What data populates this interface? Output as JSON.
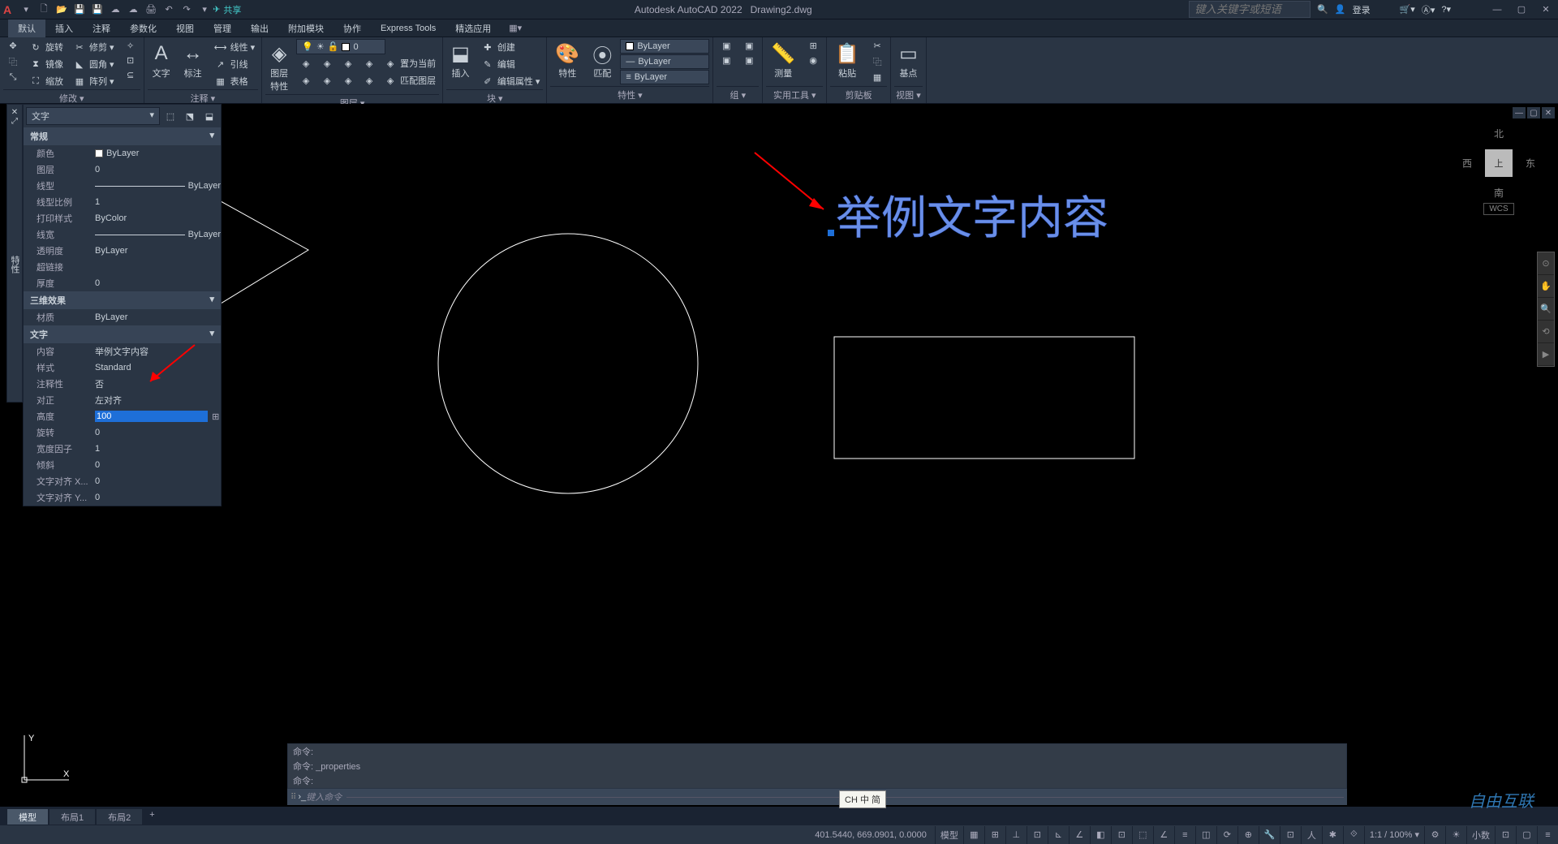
{
  "title": {
    "app": "Autodesk AutoCAD 2022",
    "file": "Drawing2.dwg"
  },
  "qat_share": "共享",
  "search_placeholder": "键入关键字或短语",
  "login": "登录",
  "menu_tabs": [
    "默认",
    "插入",
    "注释",
    "参数化",
    "视图",
    "管理",
    "输出",
    "附加模块",
    "协作",
    "Express Tools",
    "精选应用"
  ],
  "ribbon": {
    "modify": {
      "label": "修改 ▾",
      "rotate": "旋转",
      "trim": "修剪 ▾",
      "mirror": "镜像",
      "fillet": "圆角 ▾",
      "scale": "缩放",
      "array": "阵列 ▾"
    },
    "annot": {
      "label": "注释 ▾",
      "text": "文字",
      "dim": "标注",
      "linear": "线性 ▾",
      "leader": "引线",
      "table": "表格"
    },
    "layers": {
      "label": "图层 ▾",
      "props": "图层\n特性",
      "current": "置为当前",
      "match": "匹配图层",
      "combo": "0"
    },
    "block": {
      "label": "块 ▾",
      "insert": "插入",
      "create": "创建",
      "edit": "编辑",
      "editattr": "编辑属性 ▾"
    },
    "props": {
      "label": "特性 ▾",
      "btn": "特性",
      "match": "匹配",
      "layer1": "ByLayer",
      "layer2": "ByLayer",
      "layer3": "ByLayer"
    },
    "group": {
      "label": "组 ▾"
    },
    "util": {
      "label": "实用工具 ▾",
      "measure": "测量"
    },
    "clip": {
      "label": "剪贴板",
      "paste": "粘贴"
    },
    "view": {
      "label": "视图 ▾",
      "base": "基点"
    }
  },
  "props_panel": {
    "selector": "文字",
    "groups": {
      "general": "常规",
      "d3": "三维效果",
      "text": "文字"
    },
    "rows": {
      "color": {
        "k": "颜色",
        "v": "ByLayer"
      },
      "layer": {
        "k": "图层",
        "v": "0"
      },
      "ltype": {
        "k": "线型",
        "v": "ByLayer"
      },
      "ltscale": {
        "k": "线型比例",
        "v": "1"
      },
      "pstyle": {
        "k": "打印样式",
        "v": "ByColor"
      },
      "lweight": {
        "k": "线宽",
        "v": "ByLayer"
      },
      "transp": {
        "k": "透明度",
        "v": "ByLayer"
      },
      "hyper": {
        "k": "超链接",
        "v": ""
      },
      "thick": {
        "k": "厚度",
        "v": "0"
      },
      "material": {
        "k": "材质",
        "v": "ByLayer"
      },
      "content": {
        "k": "内容",
        "v": "举例文字内容"
      },
      "tstyle": {
        "k": "样式",
        "v": "Standard"
      },
      "annot": {
        "k": "注释性",
        "v": "否"
      },
      "justify": {
        "k": "对正",
        "v": "左对齐"
      },
      "height": {
        "k": "高度",
        "v": "100"
      },
      "rotate": {
        "k": "旋转",
        "v": "0"
      },
      "wfactor": {
        "k": "宽度因子",
        "v": "1"
      },
      "oblique": {
        "k": "倾斜",
        "v": "0"
      },
      "alignx": {
        "k": "文字对齐 X...",
        "v": "0"
      },
      "aligny": {
        "k": "文字对齐 Y...",
        "v": "0"
      }
    },
    "rail_text": "特性"
  },
  "canvas_text": "举例文字内容",
  "viewcube": {
    "n": "北",
    "s": "南",
    "e": "东",
    "w": "西",
    "top": "上",
    "wcs": "WCS"
  },
  "cmd": {
    "h1": "命令:",
    "h2": "命令: _properties",
    "h3": "命令:",
    "prompt": "键入命令"
  },
  "ime": "CH 中 简",
  "model_tabs": {
    "model": "模型",
    "l1": "布局1",
    "l2": "布局2"
  },
  "status": {
    "coords": "401.5440, 669.0901, 0.0000",
    "model": "模型",
    "scale": "1:1 / 100% ▾",
    "dec": "小数"
  },
  "watermark": "自由互联",
  "ucs": {
    "x": "X",
    "y": "Y"
  }
}
